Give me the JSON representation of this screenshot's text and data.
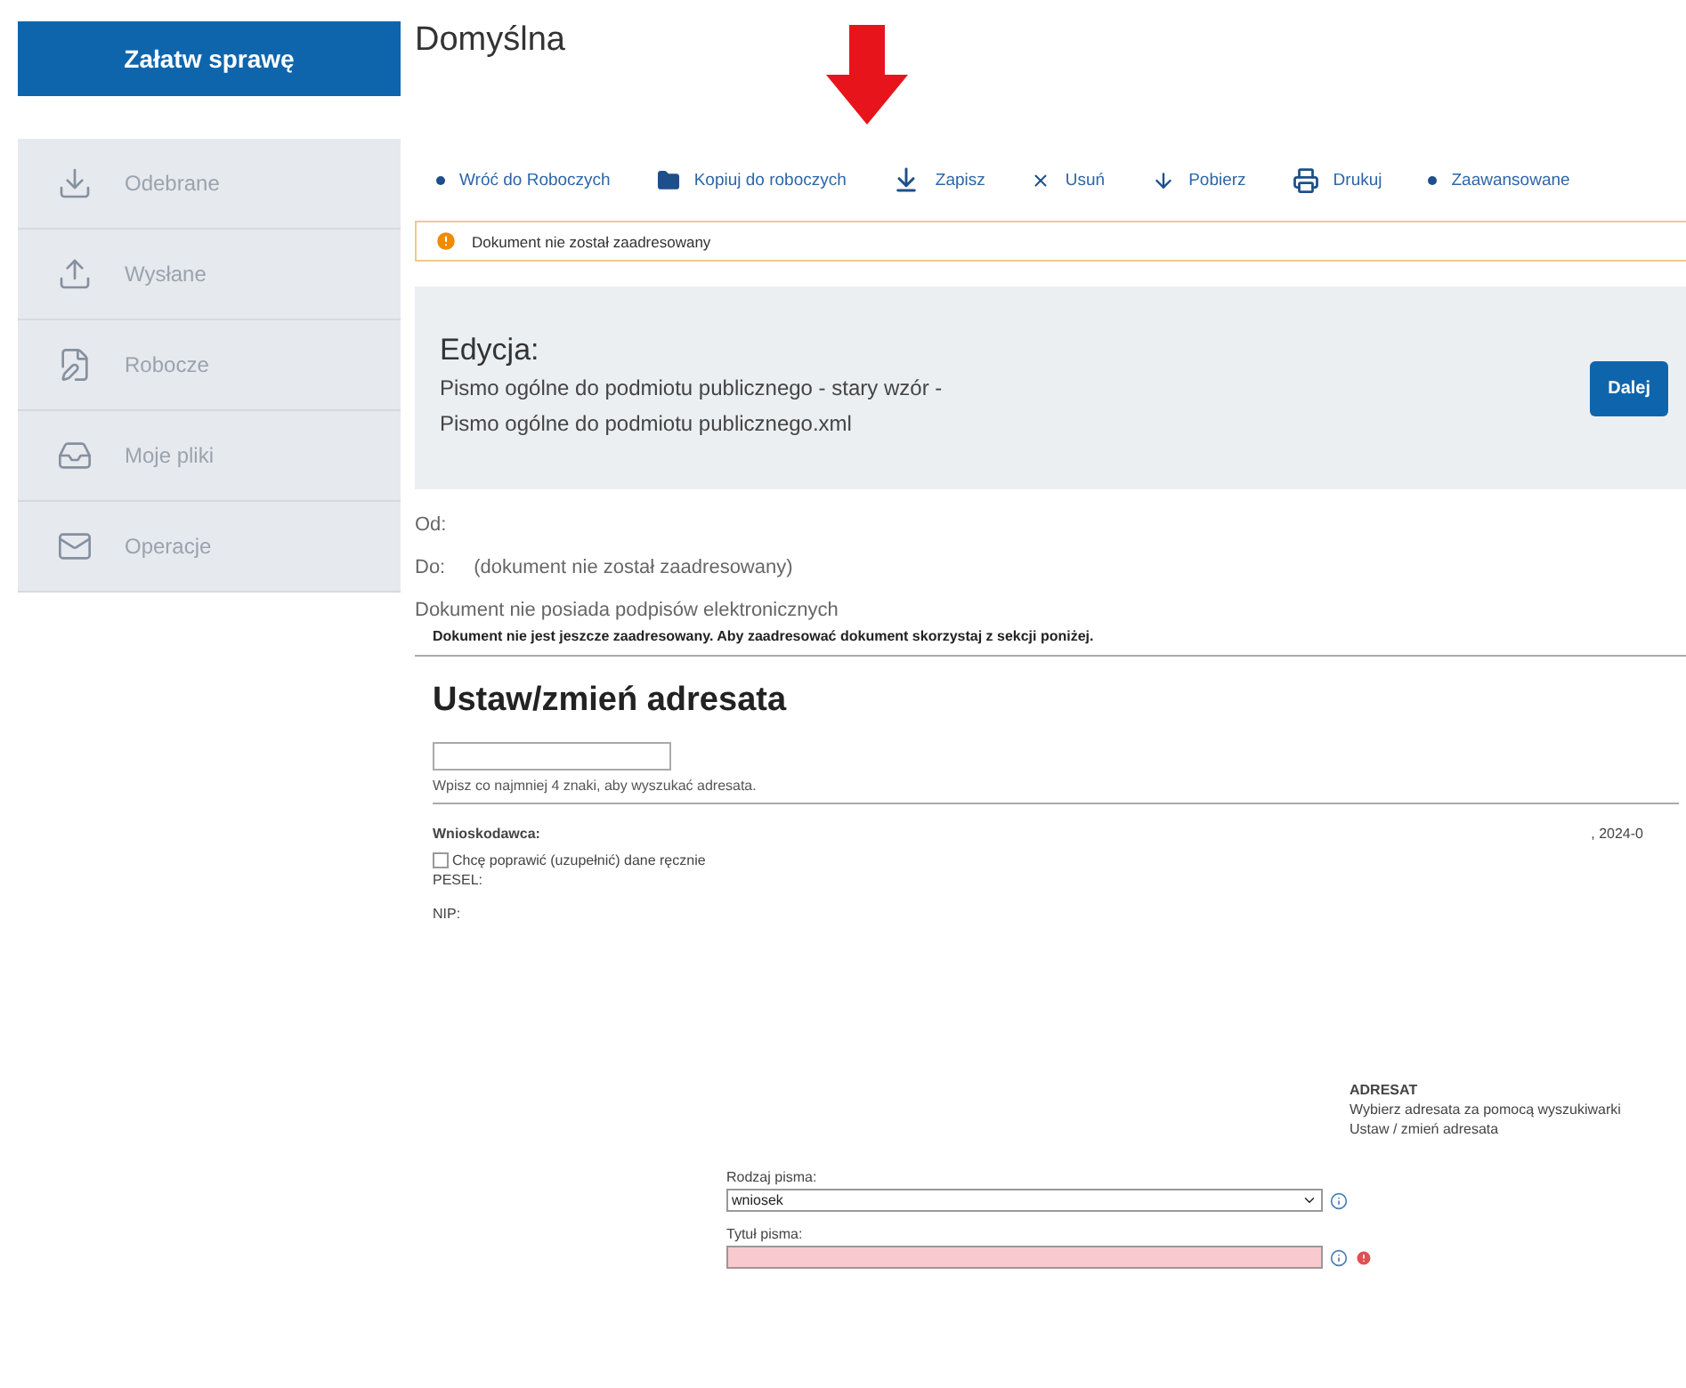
{
  "sidebar": {
    "primary_button": "Załatw sprawę",
    "items": [
      {
        "label": "Odebrane",
        "kind": "inbox",
        "selected": false
      },
      {
        "label": "Wysłane",
        "kind": "sent",
        "selected": false
      },
      {
        "label": "Robocze",
        "kind": "draft",
        "selected": false
      },
      {
        "label": "Moje pliki",
        "kind": "files",
        "selected": false
      },
      {
        "label": "Operacje",
        "kind": "mail",
        "selected": false
      }
    ]
  },
  "page_title": "Domyślna",
  "toolbar": [
    {
      "label": "Wróć do Roboczych",
      "kind": "back"
    },
    {
      "label": "Kopiuj do roboczych",
      "kind": "copy"
    },
    {
      "label": "Zapisz",
      "kind": "save"
    },
    {
      "label": "Usuń",
      "kind": "delete"
    },
    {
      "label": "Pobierz",
      "kind": "download"
    },
    {
      "label": "Drukuj",
      "kind": "print"
    },
    {
      "label": "Zaawansowane",
      "kind": "back"
    }
  ],
  "warning": "Dokument nie został zaadresowany",
  "edit_panel": {
    "heading": "Edycja:",
    "document": "Pismo ogólne do podmiotu publicznego - stary wzór - Pismo ogólne do podmiotu publicznego.xml",
    "button": "Dalej"
  },
  "meta": {
    "from_label": "Od:",
    "to_label": "Do:",
    "to_value": "(dokument nie został zaadresowany)",
    "signatures": "Dokument nie posiada podpisów elektronicznych"
  },
  "form": {
    "notice": "Dokument nie jest jeszcze zaadresowany. Aby zaadresować dokument skorzystaj z sekcji poniżej.",
    "heading": "Ustaw/zmień adresata",
    "search_hint": "Wpisz co najmniej 4 znaki, aby wyszukać adresata.",
    "applicant_label": "Wnioskodawca:",
    "date": ", 2024-0",
    "correct_checkbox": {
      "label": "Chcę poprawić (uzupełnić) dane ręcznie",
      "checked": false
    },
    "pesel_label": "PESEL:",
    "nip_label": "NIP:",
    "recipient_heading": "ADRESAT",
    "recipient_text_1": "Wybierz adresata za pomocą wyszukiwarki",
    "recipient_text_2": "Ustaw / zmień adresata",
    "type_label": "Rodzaj pisma:",
    "type_value": "wniosek",
    "title_label": "Tytuł pisma:",
    "title_invalid": true
  }
}
